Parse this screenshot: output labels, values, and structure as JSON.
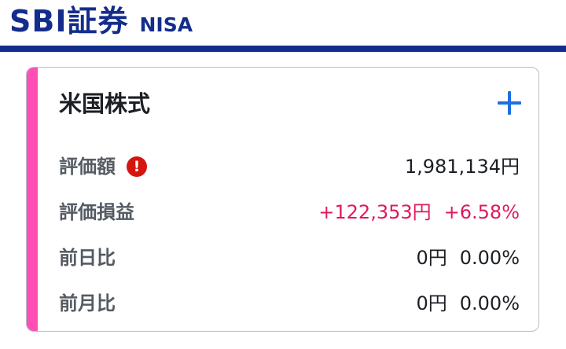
{
  "header": {
    "brand": "SBI証券",
    "account_type": "NISA",
    "brand_color": "#142d8c"
  },
  "card": {
    "title": "米国株式",
    "add_icon": "plus-icon",
    "accent_color": "#ff4fb7",
    "rows": [
      {
        "label": "評価額",
        "has_alert": true,
        "alert_icon": "exclamation-icon",
        "alert_symbol": "!",
        "value": "1,981,134円"
      },
      {
        "label": "評価損益",
        "amount": "+122,353円",
        "percent": "+6.58%",
        "value_color": "#e0185f"
      },
      {
        "label": "前日比",
        "amount": "0円",
        "percent": "0.00%"
      },
      {
        "label": "前月比",
        "amount": "0円",
        "percent": "0.00%"
      }
    ]
  }
}
